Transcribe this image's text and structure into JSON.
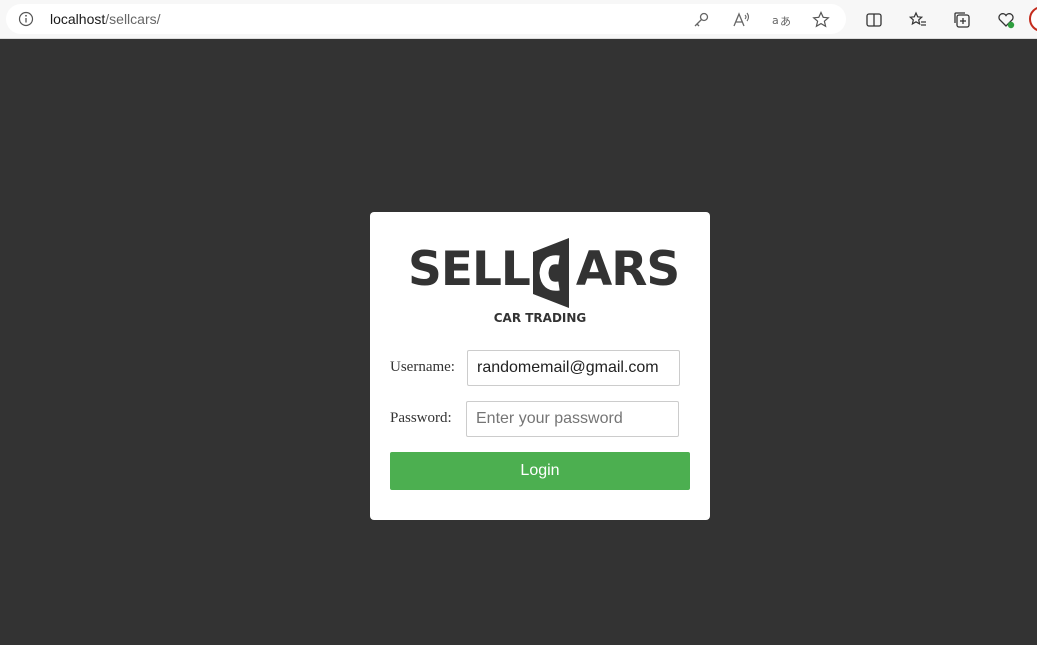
{
  "browser": {
    "url_host": "localhost",
    "url_path": "/sellcars/",
    "icons": [
      "info-icon",
      "key-icon",
      "read-aloud-icon",
      "translate-icon",
      "favorite-star-icon",
      "split-screen-icon",
      "favorites-icon",
      "collections-icon",
      "browser-essentials-icon"
    ]
  },
  "logo": {
    "brand_text_1": "SELL",
    "brand_text_2": "ARS",
    "tagline": "CAR TRADING"
  },
  "form": {
    "username_label": "Username:",
    "username_value": "randomemail@gmail.com",
    "password_label": "Password:",
    "password_placeholder": "Enter your password",
    "login_label": "Login"
  },
  "colors": {
    "background": "#333333",
    "card": "#ffffff",
    "button": "#4caf50"
  }
}
